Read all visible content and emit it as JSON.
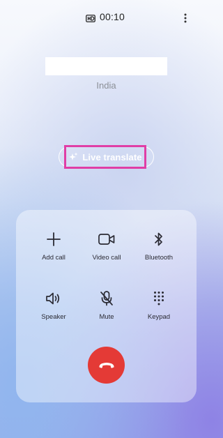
{
  "status": {
    "timer": "00:10",
    "hd_icon": "hd-voice-icon",
    "menu_icon": "more-vert-icon"
  },
  "contact": {
    "name": "",
    "location": "India"
  },
  "live_translate": {
    "label": "Live translate",
    "icon": "sparkle-icon",
    "highlight_color": "#e03ea6"
  },
  "controls": {
    "add_call": "Add call",
    "video_call": "Video call",
    "bluetooth": "Bluetooth",
    "speaker": "Speaker",
    "mute": "Mute",
    "keypad": "Keypad"
  },
  "end_call": {
    "icon": "end-call-icon",
    "color": "#e43a36"
  }
}
